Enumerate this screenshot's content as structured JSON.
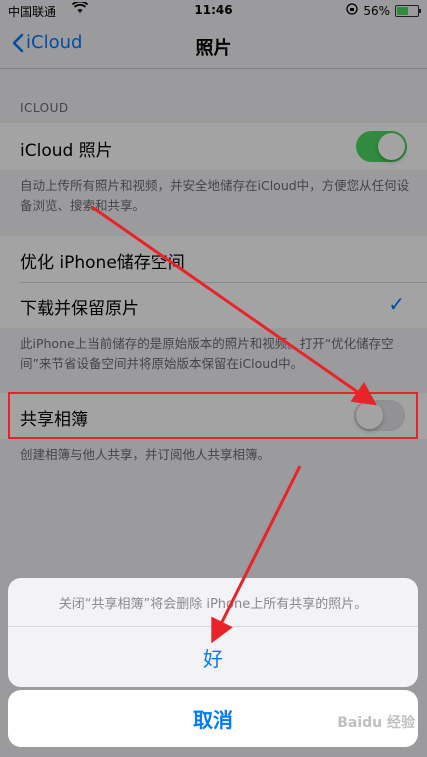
{
  "status_bar": {
    "carrier": "中国联通",
    "time": "11:46",
    "battery": "56%",
    "battery_level": 0.56
  },
  "nav": {
    "back_label": "iCloud",
    "title": "照片"
  },
  "icloud_section": {
    "header": "ICLOUD",
    "photos_label": "iCloud 照片",
    "photos_on": true,
    "footer": "自动上传所有照片和视频，并安全地储存在iCloud中，方便您从任何设备浏览、搜索和共享。"
  },
  "storage_section": {
    "optimize_label": "优化 iPhone储存空间",
    "download_label": "下载并保留原片",
    "checkmark": "✓",
    "footer": "此iPhone上当前储存的是原始版本的照片和视频。打开“优化储存空间”来节省设备空间并将原始版本保留在iCloud中。"
  },
  "shared_section": {
    "shared_label": "共享相簿",
    "shared_on": false,
    "footer": "创建相簿与他人共享，并订阅他人共享相簿。"
  },
  "action_sheet": {
    "message": "关闭“共享相簿”将会删除 iPhone上所有共享的照片。",
    "confirm_label": "好",
    "cancel_label": "取消"
  },
  "watermark": "Baidu 经验",
  "colors": {
    "accent": "#007aff",
    "toggle_on": "#4cd964",
    "annotation": "#e8242a"
  }
}
